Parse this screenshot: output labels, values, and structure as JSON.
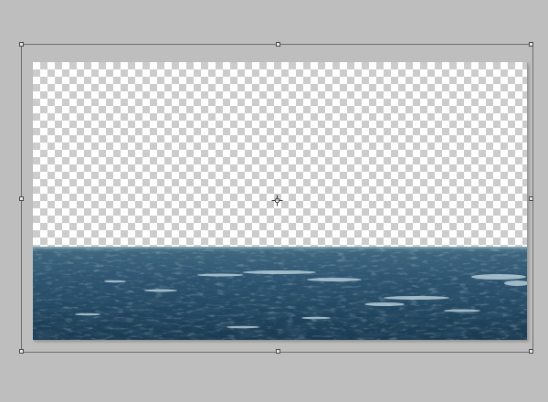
{
  "app": {
    "context": "image-editor-free-transform"
  },
  "canvas": {
    "transparent_pattern": "checkerboard",
    "layer": {
      "content": "sea-water-photo",
      "colors": {
        "horizon": "#5f8597",
        "deep_water": "#1c3b52",
        "mid_water": "#2c5370",
        "foam": "#b9d3df"
      }
    }
  },
  "transform": {
    "mode": "free-transform",
    "handles": [
      "top-left",
      "top-center",
      "top-right",
      "middle-left",
      "middle-right",
      "bottom-left",
      "bottom-center",
      "bottom-right"
    ],
    "reference_point_icon": "crosshair-icon",
    "box_color": "#6f6f6f"
  },
  "colors": {
    "workspace_bg": "#bebebe",
    "checker_light": "#ffffff",
    "checker_dark": "#cccccc"
  }
}
